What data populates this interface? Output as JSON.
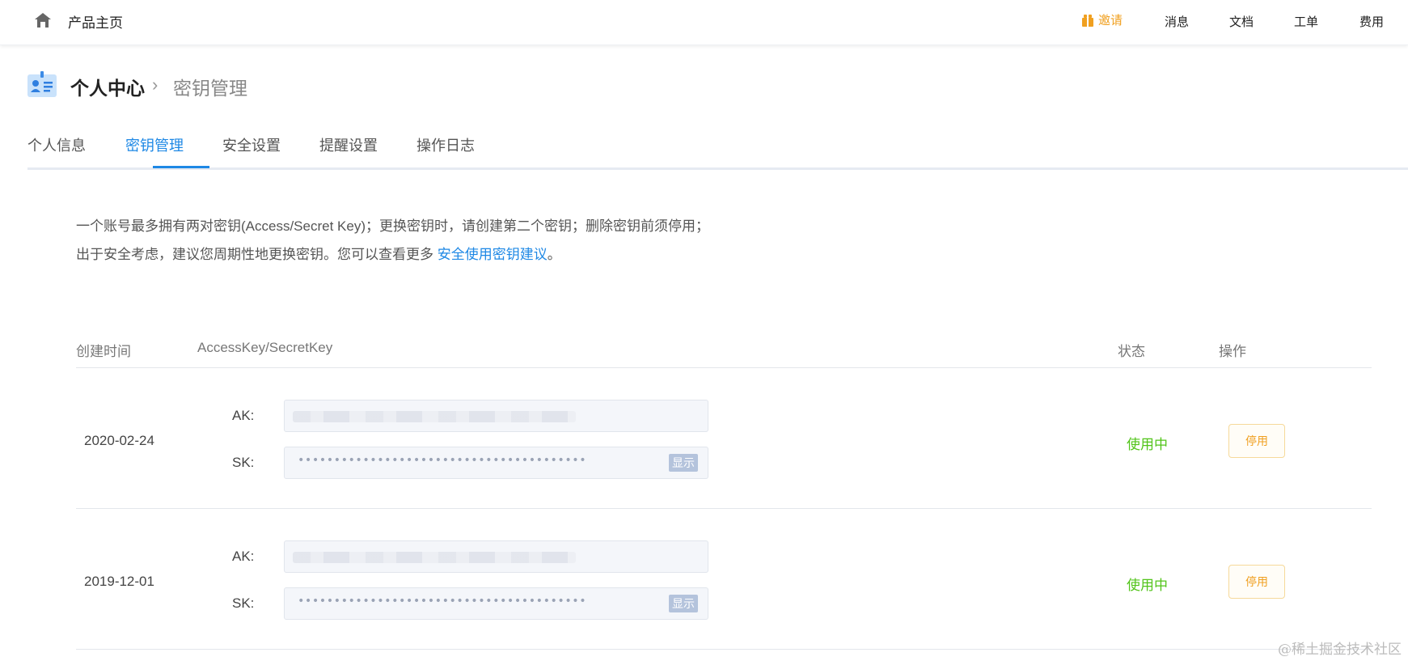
{
  "topbar": {
    "product_home": "产品主页",
    "nav": {
      "invite": "邀请",
      "messages": "消息",
      "docs": "文档",
      "tickets": "工单",
      "billing": "费用"
    }
  },
  "breadcrumb": {
    "main": "个人中心",
    "separator": "›",
    "current": "密钥管理"
  },
  "tabs": [
    "个人信息",
    "密钥管理",
    "安全设置",
    "提醒设置",
    "操作日志"
  ],
  "active_tab": "密钥管理",
  "notice": {
    "text": "一个账号最多拥有两对密钥(Access/Secret Key)；更换密钥时，请创建第二个密钥；删除密钥前须停用；出于安全考虑，建议您周期性地更换密钥。您可以查看更多 ",
    "link": "安全使用密钥建议",
    "end": "。"
  },
  "table": {
    "headers": {
      "created": "创建时间",
      "keys": "AccessKey/SecretKey",
      "status": "状态",
      "actions": "操作"
    },
    "ak_label": "AK:",
    "sk_label": "SK:",
    "sk_masked": "••••••••••••••••••••••••••••••••••••••••",
    "show_label": "显示",
    "rows": [
      {
        "date": "2020-02-24",
        "status": "使用中",
        "action": "停用"
      },
      {
        "date": "2019-12-01",
        "status": "使用中",
        "action": "停用"
      }
    ]
  },
  "watermark": "@稀土掘金技术社区",
  "colors": {
    "accent": "#1e88e5",
    "status_active": "#52c41a",
    "warning": "#f0a020"
  }
}
